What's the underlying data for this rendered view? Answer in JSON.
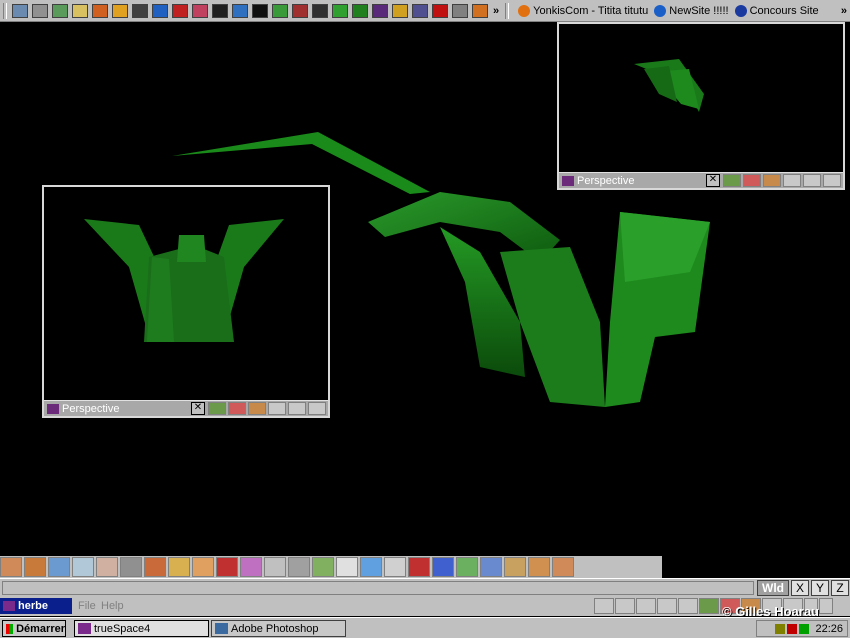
{
  "top_bar": {
    "icons": [
      "shortcut-icon",
      "drive-icon",
      "search-icon",
      "folder-icon",
      "runner-icon",
      "player-icon",
      "cursor-icon",
      "ie-icon",
      "target-icon",
      "eye-icon",
      "x-icon",
      "cube-icon",
      "user-icon",
      "globe-icon",
      "image-icon",
      "film-icon",
      "paint-icon",
      "pen-icon",
      "book-icon",
      "pencil-icon",
      "tools-icon",
      "acrobat-icon",
      "calculator-icon",
      "sun-icon"
    ],
    "chevron": "»",
    "links": [
      "YonkisCom - Titita titutu",
      "NewSite !!!!!",
      "Concours Site"
    ],
    "link_colors": [
      "#c01010",
      "#1a5fc8",
      "#1a3aa0"
    ],
    "end_chevron": "»"
  },
  "viewports": {
    "main_label": "",
    "left_title": "Perspective",
    "right_title": "Perspective",
    "close_label": "✕",
    "model_color": "#1a7a1a"
  },
  "toolbar": {
    "tool_icons": [
      "rotate-icon",
      "box-icon",
      "plane-icon",
      "select-icon",
      "scale-icon",
      "down-arrow-icon",
      "cube-icon",
      "sweep-icon",
      "sphere-icon",
      "paint-icon",
      "mesh-icon",
      "lasso-icon",
      "ruler-icon",
      "object-icon",
      "list-icon",
      "shape-icon",
      "figure-icon",
      "axis-icon",
      "grid-icon",
      "texture-icon",
      "3d-icon",
      "render-icon",
      "camera-icon",
      "light-icon"
    ]
  },
  "axis_buttons": [
    "Wld",
    "X",
    "Y",
    "Z"
  ],
  "scene": {
    "name": "herbe",
    "menus": [
      "File",
      "Help"
    ],
    "watermark": "© Gilles Hoarau"
  },
  "taskbar": {
    "start_label": "Démarrer",
    "tasks": [
      {
        "label": "trueSpace4",
        "active": true
      },
      {
        "label": "Adobe Photoshop",
        "active": false
      }
    ],
    "clock": "22:26"
  }
}
